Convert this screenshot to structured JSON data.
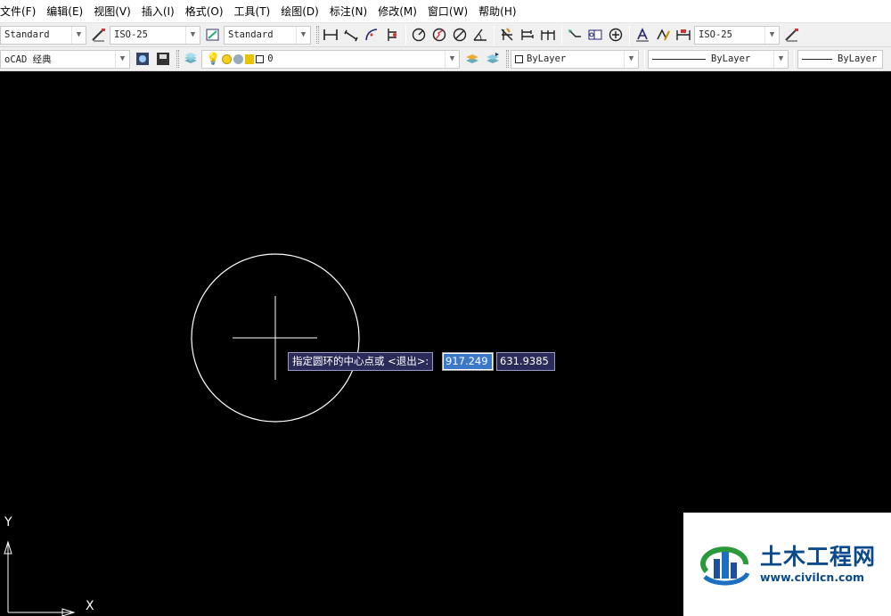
{
  "menu": [
    "文件(F)",
    "编辑(E)",
    "视图(V)",
    "插入(I)",
    "格式(O)",
    "工具(T)",
    "绘图(D)",
    "标注(N)",
    "修改(M)",
    "窗口(W)",
    "帮助(H)"
  ],
  "toolbar1": {
    "text_style": "Standard",
    "dim_style": "ISO-25",
    "table_style": "Standard",
    "dim_style_right": "ISO-25"
  },
  "toolbar2": {
    "workspace": "oCAD 经典",
    "layer": "0",
    "color": "ByLayer",
    "linetype": "ByLayer",
    "lineweight": "ByLayer"
  },
  "command_prompt": {
    "text": "指定圆环的中心点或 <退出>:",
    "x_value": "917.249",
    "y_value": "631.9385"
  },
  "ucs": {
    "y_label": "Y",
    "x_label": "X"
  },
  "watermark": {
    "title": "土木工程网",
    "url": "www.civilcn.com"
  },
  "colors": {
    "canvas": "#000000",
    "prompt_bg": "#2b2b5a",
    "highlight": "#3b78c8",
    "brand": "#0b4a8a"
  }
}
